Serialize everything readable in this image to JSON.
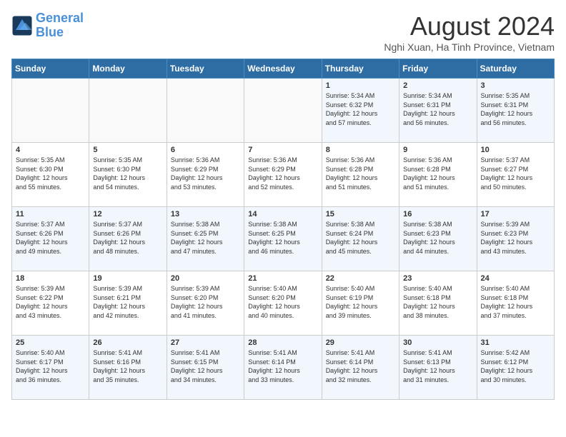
{
  "header": {
    "logo_line1": "General",
    "logo_line2": "Blue",
    "month_title": "August 2024",
    "subtitle": "Nghi Xuan, Ha Tinh Province, Vietnam"
  },
  "weekdays": [
    "Sunday",
    "Monday",
    "Tuesday",
    "Wednesday",
    "Thursday",
    "Friday",
    "Saturday"
  ],
  "weeks": [
    [
      {
        "day": "",
        "info": ""
      },
      {
        "day": "",
        "info": ""
      },
      {
        "day": "",
        "info": ""
      },
      {
        "day": "",
        "info": ""
      },
      {
        "day": "1",
        "info": "Sunrise: 5:34 AM\nSunset: 6:32 PM\nDaylight: 12 hours\nand 57 minutes."
      },
      {
        "day": "2",
        "info": "Sunrise: 5:34 AM\nSunset: 6:31 PM\nDaylight: 12 hours\nand 56 minutes."
      },
      {
        "day": "3",
        "info": "Sunrise: 5:35 AM\nSunset: 6:31 PM\nDaylight: 12 hours\nand 56 minutes."
      }
    ],
    [
      {
        "day": "4",
        "info": "Sunrise: 5:35 AM\nSunset: 6:30 PM\nDaylight: 12 hours\nand 55 minutes."
      },
      {
        "day": "5",
        "info": "Sunrise: 5:35 AM\nSunset: 6:30 PM\nDaylight: 12 hours\nand 54 minutes."
      },
      {
        "day": "6",
        "info": "Sunrise: 5:36 AM\nSunset: 6:29 PM\nDaylight: 12 hours\nand 53 minutes."
      },
      {
        "day": "7",
        "info": "Sunrise: 5:36 AM\nSunset: 6:29 PM\nDaylight: 12 hours\nand 52 minutes."
      },
      {
        "day": "8",
        "info": "Sunrise: 5:36 AM\nSunset: 6:28 PM\nDaylight: 12 hours\nand 51 minutes."
      },
      {
        "day": "9",
        "info": "Sunrise: 5:36 AM\nSunset: 6:28 PM\nDaylight: 12 hours\nand 51 minutes."
      },
      {
        "day": "10",
        "info": "Sunrise: 5:37 AM\nSunset: 6:27 PM\nDaylight: 12 hours\nand 50 minutes."
      }
    ],
    [
      {
        "day": "11",
        "info": "Sunrise: 5:37 AM\nSunset: 6:26 PM\nDaylight: 12 hours\nand 49 minutes."
      },
      {
        "day": "12",
        "info": "Sunrise: 5:37 AM\nSunset: 6:26 PM\nDaylight: 12 hours\nand 48 minutes."
      },
      {
        "day": "13",
        "info": "Sunrise: 5:38 AM\nSunset: 6:25 PM\nDaylight: 12 hours\nand 47 minutes."
      },
      {
        "day": "14",
        "info": "Sunrise: 5:38 AM\nSunset: 6:25 PM\nDaylight: 12 hours\nand 46 minutes."
      },
      {
        "day": "15",
        "info": "Sunrise: 5:38 AM\nSunset: 6:24 PM\nDaylight: 12 hours\nand 45 minutes."
      },
      {
        "day": "16",
        "info": "Sunrise: 5:38 AM\nSunset: 6:23 PM\nDaylight: 12 hours\nand 44 minutes."
      },
      {
        "day": "17",
        "info": "Sunrise: 5:39 AM\nSunset: 6:23 PM\nDaylight: 12 hours\nand 43 minutes."
      }
    ],
    [
      {
        "day": "18",
        "info": "Sunrise: 5:39 AM\nSunset: 6:22 PM\nDaylight: 12 hours\nand 43 minutes."
      },
      {
        "day": "19",
        "info": "Sunrise: 5:39 AM\nSunset: 6:21 PM\nDaylight: 12 hours\nand 42 minutes."
      },
      {
        "day": "20",
        "info": "Sunrise: 5:39 AM\nSunset: 6:20 PM\nDaylight: 12 hours\nand 41 minutes."
      },
      {
        "day": "21",
        "info": "Sunrise: 5:40 AM\nSunset: 6:20 PM\nDaylight: 12 hours\nand 40 minutes."
      },
      {
        "day": "22",
        "info": "Sunrise: 5:40 AM\nSunset: 6:19 PM\nDaylight: 12 hours\nand 39 minutes."
      },
      {
        "day": "23",
        "info": "Sunrise: 5:40 AM\nSunset: 6:18 PM\nDaylight: 12 hours\nand 38 minutes."
      },
      {
        "day": "24",
        "info": "Sunrise: 5:40 AM\nSunset: 6:18 PM\nDaylight: 12 hours\nand 37 minutes."
      }
    ],
    [
      {
        "day": "25",
        "info": "Sunrise: 5:40 AM\nSunset: 6:17 PM\nDaylight: 12 hours\nand 36 minutes."
      },
      {
        "day": "26",
        "info": "Sunrise: 5:41 AM\nSunset: 6:16 PM\nDaylight: 12 hours\nand 35 minutes."
      },
      {
        "day": "27",
        "info": "Sunrise: 5:41 AM\nSunset: 6:15 PM\nDaylight: 12 hours\nand 34 minutes."
      },
      {
        "day": "28",
        "info": "Sunrise: 5:41 AM\nSunset: 6:14 PM\nDaylight: 12 hours\nand 33 minutes."
      },
      {
        "day": "29",
        "info": "Sunrise: 5:41 AM\nSunset: 6:14 PM\nDaylight: 12 hours\nand 32 minutes."
      },
      {
        "day": "30",
        "info": "Sunrise: 5:41 AM\nSunset: 6:13 PM\nDaylight: 12 hours\nand 31 minutes."
      },
      {
        "day": "31",
        "info": "Sunrise: 5:42 AM\nSunset: 6:12 PM\nDaylight: 12 hours\nand 30 minutes."
      }
    ]
  ]
}
